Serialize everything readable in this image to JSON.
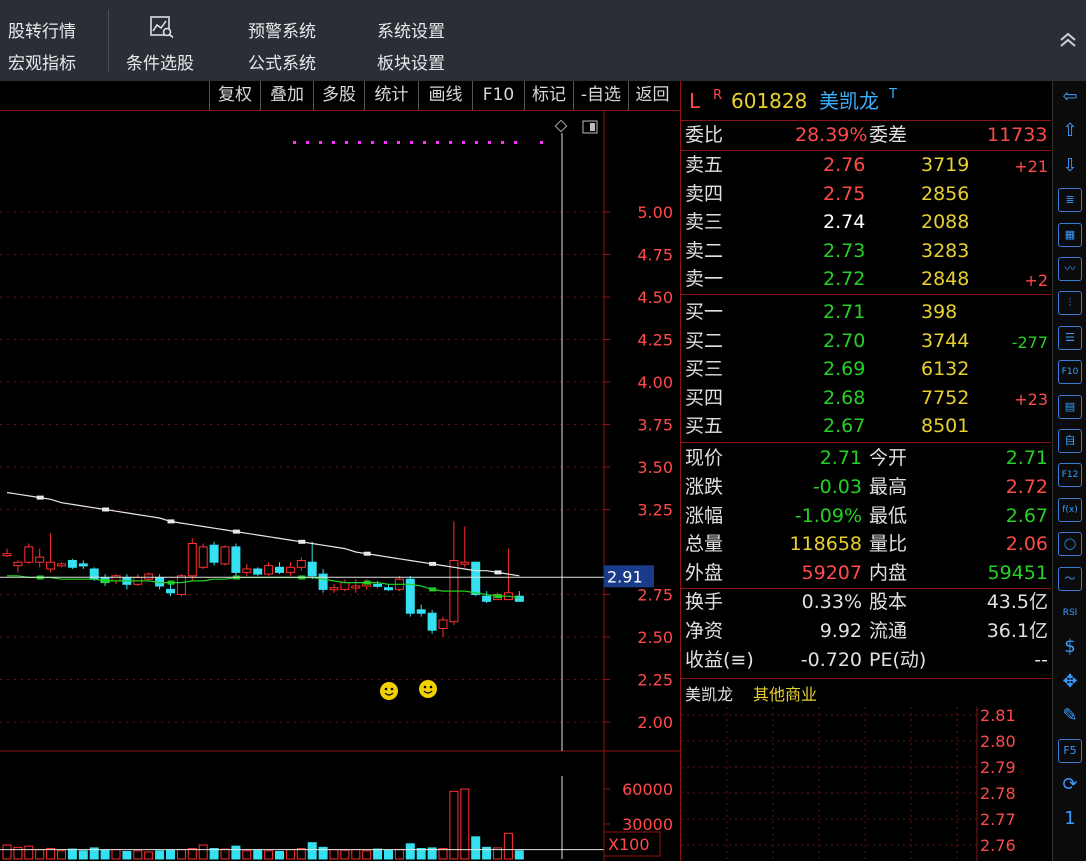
{
  "topbar": {
    "item1a": "股转行情",
    "item1b": "宏观指标",
    "item2": "条件选股",
    "item3a": "预警系统",
    "item3b": "公式系统",
    "item4a": "系统设置",
    "item4b": "板块设置"
  },
  "chart_buttons": [
    "复权",
    "叠加",
    "多股",
    "统计",
    "画线",
    "F10",
    "标记",
    "-自选",
    "返回"
  ],
  "chart": {
    "price_axis": [
      "5.00",
      "4.75",
      "4.50",
      "4.25",
      "4.00",
      "3.75",
      "3.50",
      "3.25",
      "2.75",
      "2.50",
      "2.25",
      "2.00"
    ],
    "price_min": 1.8,
    "price_max": 5.1,
    "crosshair_price": "2.91",
    "volume_axis": [
      "60000",
      "30000"
    ],
    "volume_unit": "X100",
    "colors": {
      "up": "#ff3030",
      "down": "#35e0f0",
      "ma1": "#e8e8e8",
      "ma2": "#20d020",
      "marker": "#ff30ff"
    }
  },
  "chart_data": {
    "type": "candlestick",
    "candles": [
      {
        "o": 2.99,
        "h": 3.02,
        "l": 2.97,
        "c": 2.99
      },
      {
        "o": 2.92,
        "h": 2.95,
        "l": 2.88,
        "c": 2.94
      },
      {
        "o": 2.94,
        "h": 3.05,
        "l": 2.93,
        "c": 3.03
      },
      {
        "o": 2.94,
        "h": 3.02,
        "l": 2.91,
        "c": 2.97
      },
      {
        "o": 2.9,
        "h": 3.11,
        "l": 2.88,
        "c": 2.94
      },
      {
        "o": 2.93,
        "h": 2.94,
        "l": 2.91,
        "c": 2.93
      },
      {
        "o": 2.95,
        "h": 2.96,
        "l": 2.9,
        "c": 2.91
      },
      {
        "o": 2.93,
        "h": 2.95,
        "l": 2.9,
        "c": 2.92
      },
      {
        "o": 2.9,
        "h": 2.91,
        "l": 2.83,
        "c": 2.84
      },
      {
        "o": 2.85,
        "h": 2.87,
        "l": 2.8,
        "c": 2.82
      },
      {
        "o": 2.83,
        "h": 2.87,
        "l": 2.81,
        "c": 2.86
      },
      {
        "o": 2.85,
        "h": 2.87,
        "l": 2.78,
        "c": 2.81
      },
      {
        "o": 2.81,
        "h": 2.87,
        "l": 2.8,
        "c": 2.85
      },
      {
        "o": 2.84,
        "h": 2.88,
        "l": 2.83,
        "c": 2.87
      },
      {
        "o": 2.85,
        "h": 2.87,
        "l": 2.78,
        "c": 2.8
      },
      {
        "o": 2.78,
        "h": 2.81,
        "l": 2.74,
        "c": 2.76
      },
      {
        "o": 2.75,
        "h": 2.87,
        "l": 2.74,
        "c": 2.86
      },
      {
        "o": 2.86,
        "h": 3.08,
        "l": 2.83,
        "c": 3.05
      },
      {
        "o": 2.91,
        "h": 3.05,
        "l": 2.9,
        "c": 3.03
      },
      {
        "o": 3.04,
        "h": 3.06,
        "l": 2.92,
        "c": 2.94
      },
      {
        "o": 2.93,
        "h": 3.04,
        "l": 2.92,
        "c": 3.03
      },
      {
        "o": 3.03,
        "h": 3.05,
        "l": 2.86,
        "c": 2.88
      },
      {
        "o": 2.88,
        "h": 2.93,
        "l": 2.86,
        "c": 2.9
      },
      {
        "o": 2.9,
        "h": 2.91,
        "l": 2.86,
        "c": 2.87
      },
      {
        "o": 2.87,
        "h": 2.94,
        "l": 2.86,
        "c": 2.92
      },
      {
        "o": 2.91,
        "h": 2.94,
        "l": 2.87,
        "c": 2.88
      },
      {
        "o": 2.88,
        "h": 2.94,
        "l": 2.86,
        "c": 2.91
      },
      {
        "o": 2.91,
        "h": 2.97,
        "l": 2.89,
        "c": 2.95
      },
      {
        "o": 2.94,
        "h": 3.06,
        "l": 2.84,
        "c": 2.86
      },
      {
        "o": 2.87,
        "h": 2.9,
        "l": 2.76,
        "c": 2.78
      },
      {
        "o": 2.78,
        "h": 2.81,
        "l": 2.76,
        "c": 2.79
      },
      {
        "o": 2.78,
        "h": 2.84,
        "l": 2.77,
        "c": 2.82
      },
      {
        "o": 2.79,
        "h": 2.84,
        "l": 2.76,
        "c": 2.8
      },
      {
        "o": 2.8,
        "h": 2.84,
        "l": 2.78,
        "c": 2.82
      },
      {
        "o": 2.81,
        "h": 2.83,
        "l": 2.79,
        "c": 2.8
      },
      {
        "o": 2.79,
        "h": 2.81,
        "l": 2.77,
        "c": 2.78
      },
      {
        "o": 2.78,
        "h": 2.86,
        "l": 2.77,
        "c": 2.84
      },
      {
        "o": 2.84,
        "h": 2.86,
        "l": 2.62,
        "c": 2.64
      },
      {
        "o": 2.66,
        "h": 2.69,
        "l": 2.62,
        "c": 2.64
      },
      {
        "o": 2.64,
        "h": 2.66,
        "l": 2.52,
        "c": 2.54
      },
      {
        "o": 2.55,
        "h": 2.62,
        "l": 2.5,
        "c": 2.6
      },
      {
        "o": 2.59,
        "h": 3.18,
        "l": 2.57,
        "c": 2.95
      },
      {
        "o": 2.93,
        "h": 3.15,
        "l": 2.91,
        "c": 2.94
      },
      {
        "o": 2.94,
        "h": 2.94,
        "l": 2.74,
        "c": 2.75
      },
      {
        "o": 2.74,
        "h": 2.77,
        "l": 2.7,
        "c": 2.71
      },
      {
        "o": 2.72,
        "h": 2.76,
        "l": 2.72,
        "c": 2.75
      },
      {
        "o": 2.72,
        "h": 3.02,
        "l": 2.72,
        "c": 2.76
      },
      {
        "o": 2.74,
        "h": 2.77,
        "l": 2.71,
        "c": 2.71
      }
    ],
    "ma1": [
      3.35,
      3.34,
      3.33,
      3.32,
      3.31,
      3.29,
      3.28,
      3.27,
      3.26,
      3.25,
      3.24,
      3.23,
      3.22,
      3.21,
      3.2,
      3.18,
      3.17,
      3.16,
      3.15,
      3.14,
      3.13,
      3.12,
      3.11,
      3.1,
      3.09,
      3.08,
      3.07,
      3.06,
      3.05,
      3.04,
      3.03,
      3.02,
      3.0,
      2.99,
      2.98,
      2.97,
      2.96,
      2.95,
      2.94,
      2.93,
      2.92,
      2.91,
      2.9,
      2.89,
      2.89,
      2.88,
      2.87,
      2.86
    ],
    "ma2": [
      2.86,
      2.86,
      2.85,
      2.85,
      2.85,
      2.84,
      2.84,
      2.84,
      2.84,
      2.83,
      2.83,
      2.83,
      2.83,
      2.83,
      2.82,
      2.82,
      2.82,
      2.83,
      2.83,
      2.84,
      2.84,
      2.85,
      2.85,
      2.85,
      2.85,
      2.85,
      2.85,
      2.85,
      2.85,
      2.84,
      2.83,
      2.82,
      2.82,
      2.82,
      2.82,
      2.81,
      2.81,
      2.81,
      2.8,
      2.78,
      2.77,
      2.77,
      2.77,
      2.76,
      2.75,
      2.74,
      2.74,
      2.73
    ],
    "volumes": [
      12000,
      10000,
      11000,
      8000,
      9000,
      7000,
      8500,
      7000,
      9500,
      7500,
      8000,
      6500,
      7000,
      6000,
      7000,
      7500,
      8000,
      9000,
      12000,
      9000,
      8500,
      11000,
      7000,
      7500,
      7000,
      6500,
      8000,
      9000,
      14000,
      10000,
      8000,
      7500,
      8000,
      7000,
      8500,
      7500,
      8000,
      13000,
      9000,
      9500,
      9000,
      58000,
      60000,
      19000,
      10000,
      9500,
      22000,
      7000
    ]
  },
  "quote": {
    "market": "L",
    "flag": "R",
    "code": "601828",
    "name": "美凯龙",
    "name_mark": "T",
    "weibi_label": "委比",
    "weibi": "28.39%",
    "weicha_label": "委差",
    "weicha": "11733",
    "asks": [
      {
        "label": "卖五",
        "price": "2.76",
        "vol": "3719",
        "chg": "+21"
      },
      {
        "label": "卖四",
        "price": "2.75",
        "vol": "2856",
        "chg": ""
      },
      {
        "label": "卖三",
        "price": "2.74",
        "vol": "2088",
        "chg": ""
      },
      {
        "label": "卖二",
        "price": "2.73",
        "vol": "3283",
        "chg": ""
      },
      {
        "label": "卖一",
        "price": "2.72",
        "vol": "2848",
        "chg": "+2"
      }
    ],
    "bids": [
      {
        "label": "买一",
        "price": "2.71",
        "vol": "398",
        "chg": ""
      },
      {
        "label": "买二",
        "price": "2.70",
        "vol": "3744",
        "chg": "-277"
      },
      {
        "label": "买三",
        "price": "2.69",
        "vol": "6132",
        "chg": ""
      },
      {
        "label": "买四",
        "price": "2.68",
        "vol": "7752",
        "chg": "+23"
      },
      {
        "label": "买五",
        "price": "2.67",
        "vol": "8501",
        "chg": ""
      }
    ],
    "stats": [
      {
        "l1": "现价",
        "v1": "2.71",
        "l2": "今开",
        "v2": "2.71"
      },
      {
        "l1": "涨跌",
        "v1": "-0.03",
        "l2": "最高",
        "v2": "2.72"
      },
      {
        "l1": "涨幅",
        "v1": "-1.09%",
        "l2": "最低",
        "v2": "2.67"
      },
      {
        "l1": "总量",
        "v1": "118658",
        "l2": "量比",
        "v2": "2.06"
      },
      {
        "l1": "外盘",
        "v1": "59207",
        "l2": "内盘",
        "v2": "59451"
      }
    ],
    "stats2": [
      {
        "l1": "换手",
        "v1": "0.33%",
        "l2": "股本",
        "v2": "43.5亿"
      },
      {
        "l1": "净资",
        "v1": "9.92",
        "l2": "流通",
        "v2": "36.1亿"
      },
      {
        "l1": "收益(≡)",
        "v1": "-0.720",
        "l2": "PE(动)",
        "v2": "--"
      }
    ],
    "industry_name": "美凯龙",
    "industry": "其他商业",
    "mini_axis": [
      "2.81",
      "2.80",
      "2.79",
      "2.78",
      "2.77",
      "2.76"
    ]
  },
  "right_toolbar": [
    "⇦",
    "⇧",
    "⇩",
    "",
    "",
    "",
    "",
    "",
    "F10",
    "",
    "自",
    "F12",
    "f(x)",
    "◯",
    "",
    "RSI",
    "$",
    "✥",
    "✎",
    "F5",
    "",
    "1"
  ]
}
